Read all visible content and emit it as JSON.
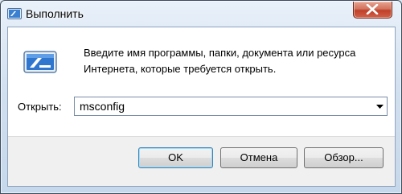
{
  "window": {
    "title": "Выполнить",
    "icons": {
      "app": "run-icon",
      "close": "close-icon",
      "main": "run-program-icon",
      "dropdown": "chevron-down-icon"
    }
  },
  "dialog": {
    "description": "Введите имя программы, папки, документа или ресурса Интернета, которые требуется открыть.",
    "open_label": "Открыть:",
    "open_value": "msconfig"
  },
  "buttons": {
    "ok": "OK",
    "cancel": "Отмена",
    "browse": "Обзор..."
  },
  "colors": {
    "close_button": "#c0402a",
    "default_button_border": "#3c7fb1"
  }
}
